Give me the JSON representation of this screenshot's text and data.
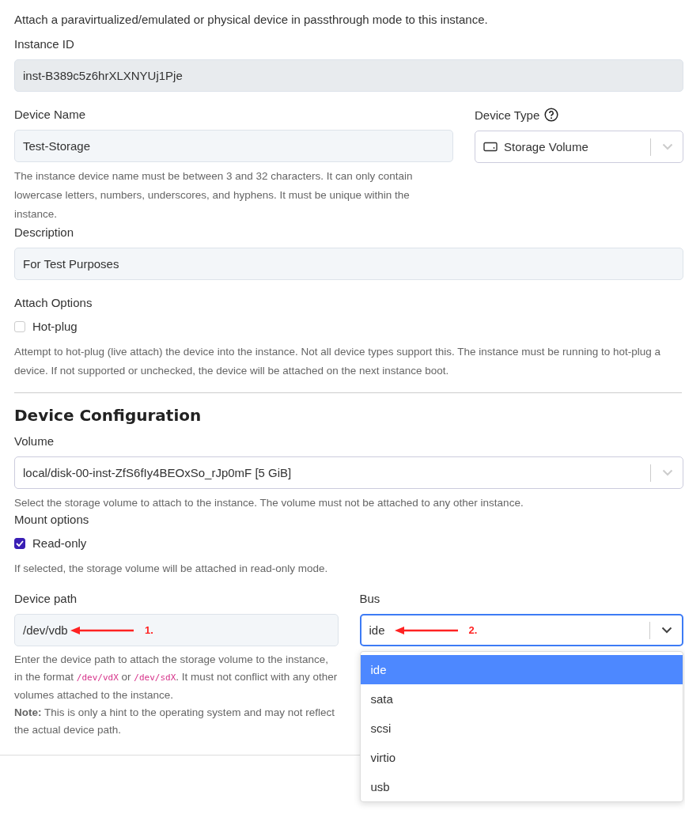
{
  "intro": "Attach a paravirtualized/emulated or physical device in passthrough mode to this instance.",
  "instance_id": {
    "label": "Instance ID",
    "value": "inst-B389c5z6hrXLXNYUj1Pje",
    "disabled": true
  },
  "device_name": {
    "label": "Device Name",
    "value": "Test-Storage",
    "help": "The instance device name must be between 3 and 32 characters. It can only contain lowercase letters, numbers, underscores, and hyphens. It must be unique within the instance."
  },
  "device_type": {
    "label": "Device Type",
    "value": "Storage Volume"
  },
  "description": {
    "label": "Description",
    "value": "For Test Purposes"
  },
  "attach_options": {
    "label": "Attach Options",
    "checkbox": {
      "label": "Hot-plug",
      "checked": false
    },
    "help": "Attempt to hot-plug (live attach) the device into the instance. Not all device types support this. The instance must be running to hot-plug a device. If not supported or unchecked, the device will be attached on the next instance boot."
  },
  "section_title": "Device Configuration",
  "volume": {
    "label": "Volume",
    "value": "local/disk-00-inst-ZfS6fIy4BEOxSo_rJp0mF [5 GiB]",
    "help": "Select the storage volume to attach to the instance. The volume must not be attached to any other instance."
  },
  "mount_options": {
    "label": "Mount options",
    "checkbox": {
      "label": "Read-only",
      "checked": true
    },
    "help": "If selected, the storage volume will be attached in read-only mode."
  },
  "device_path": {
    "label": "Device path",
    "value": "/dev/vdb",
    "annotation": "1.",
    "help": [
      {
        "kind": "text",
        "text": "Enter the device path to attach the storage volume to the instance, in the format "
      },
      {
        "kind": "code",
        "text": "/dev/vdX"
      },
      {
        "kind": "text",
        "text": " or "
      },
      {
        "kind": "code",
        "text": "/dev/sdX"
      },
      {
        "kind": "text",
        "text": ". It must not conflict with any other volumes attached to the instance."
      },
      {
        "kind": "break"
      },
      {
        "kind": "bold",
        "text": "Note:"
      },
      {
        "kind": "text",
        "text": " This is only a hint to the operating system and may not reflect the actual device path."
      }
    ]
  },
  "bus": {
    "label": "Bus",
    "value": "ide",
    "annotation": "2.",
    "focused": true,
    "expanded": true,
    "options": [
      {
        "label": "ide",
        "selected": true
      },
      {
        "label": "sata",
        "selected": false
      },
      {
        "label": "scsi",
        "selected": false
      },
      {
        "label": "virtio",
        "selected": false
      },
      {
        "label": "usb",
        "selected": false
      }
    ]
  }
}
